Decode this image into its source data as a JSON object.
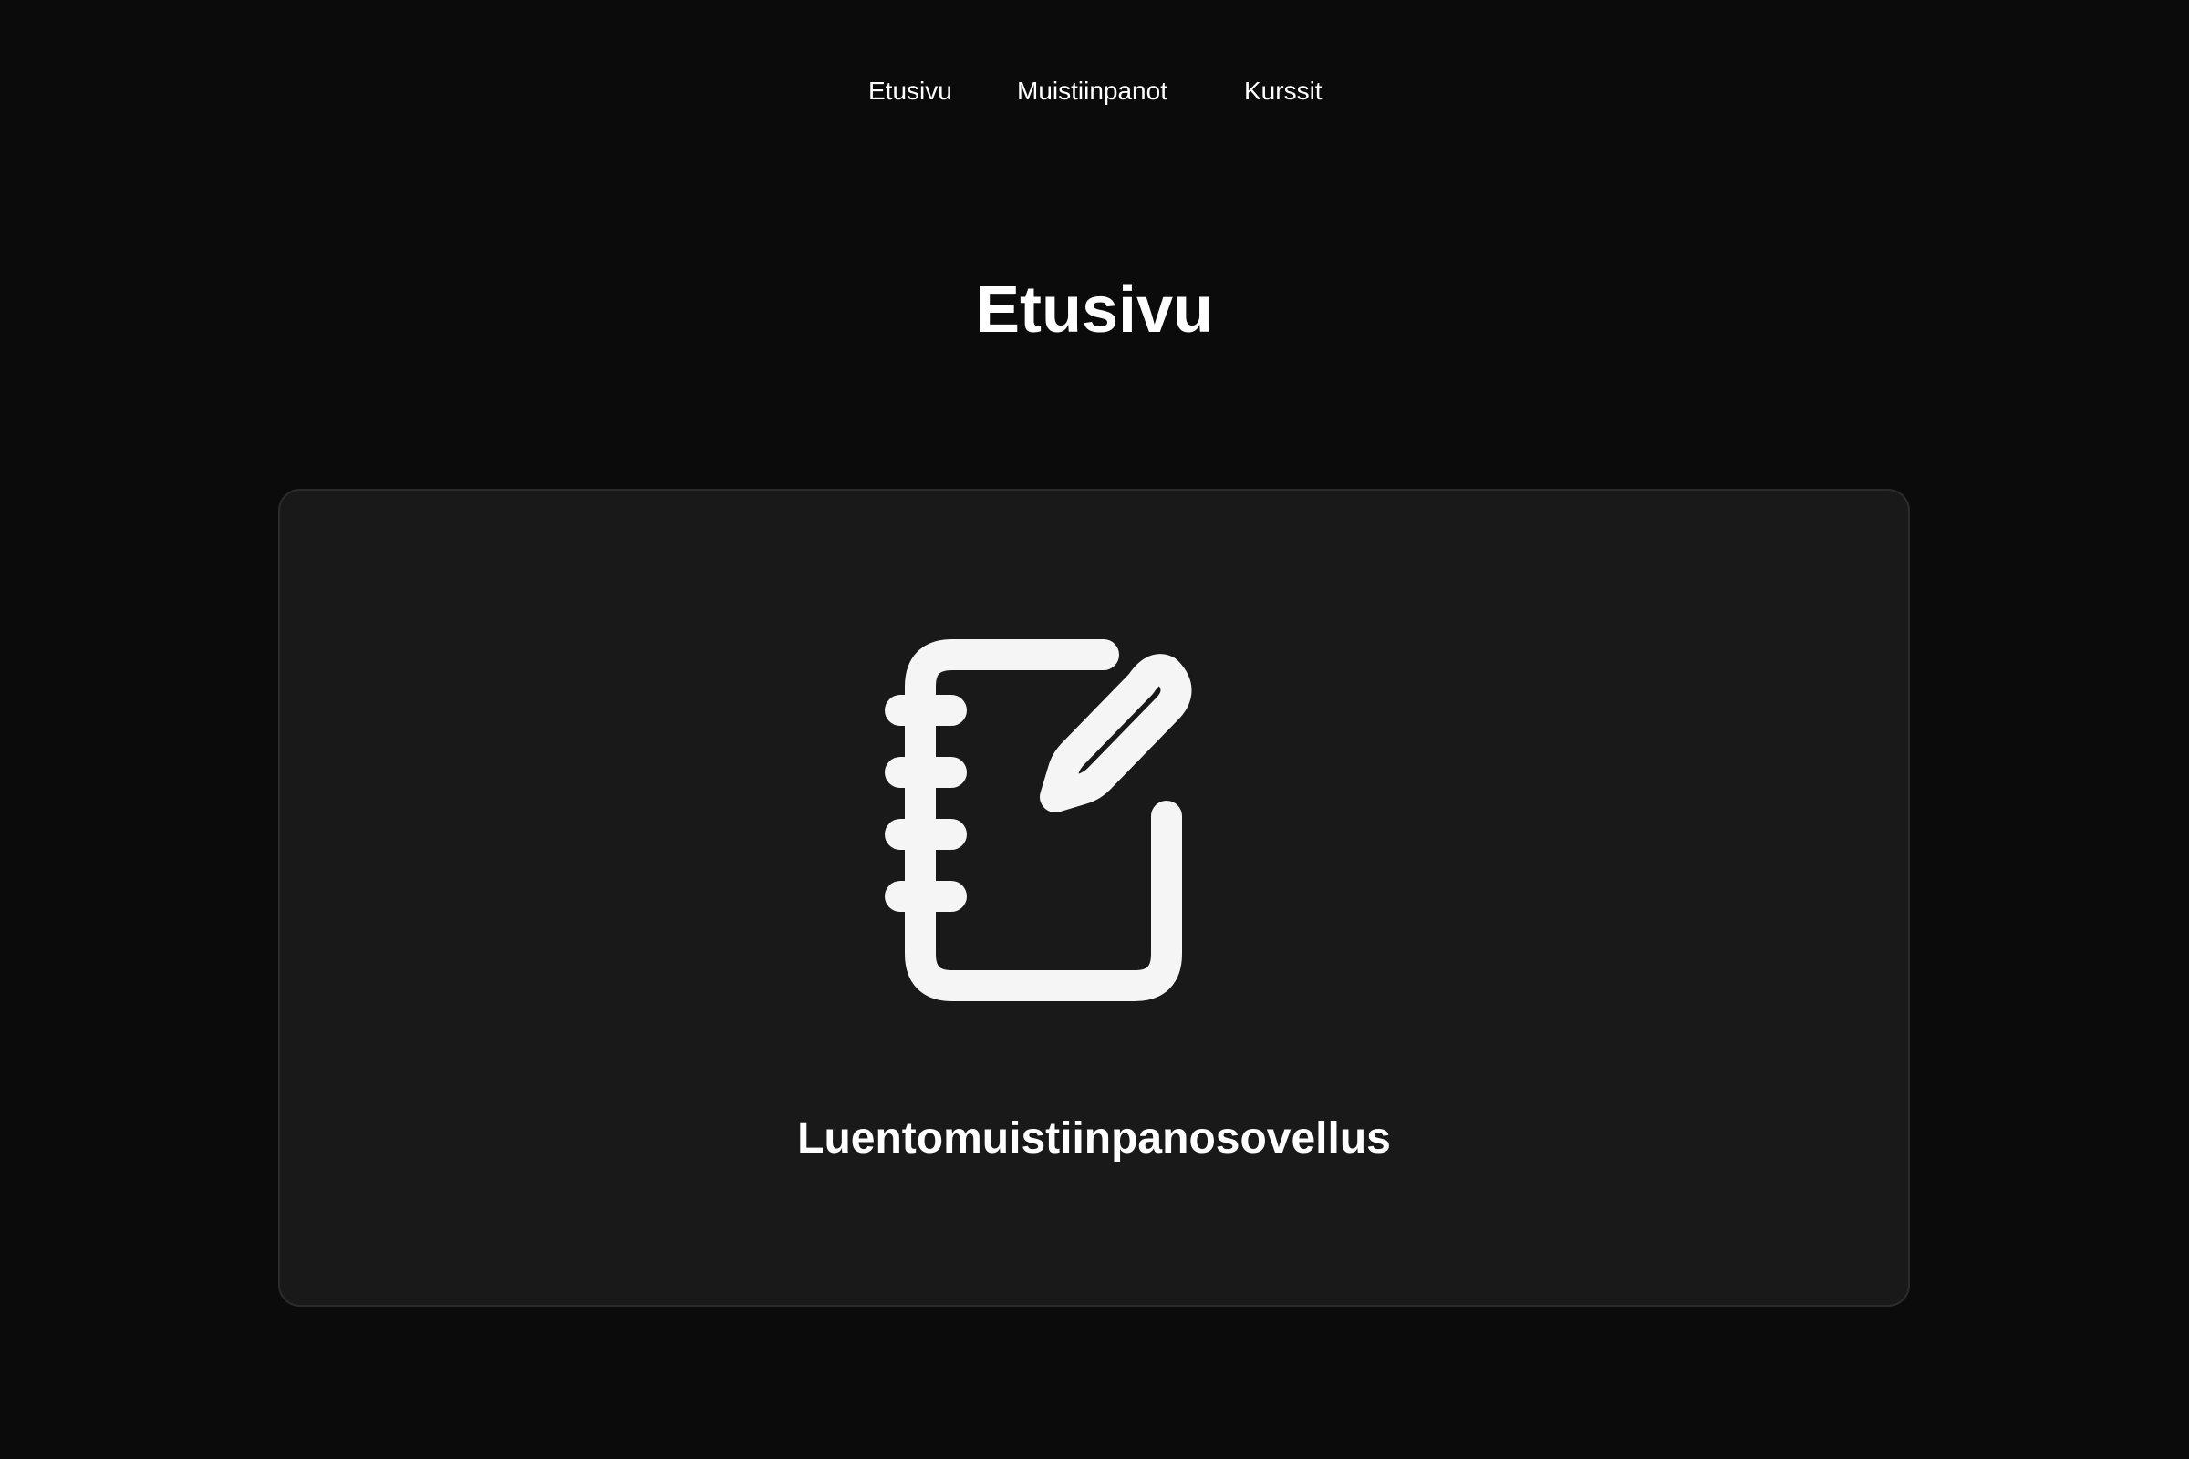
{
  "nav": {
    "items": [
      {
        "label": "Etusivu"
      },
      {
        "label": "Muistiinpanot"
      },
      {
        "label": "Kurssit"
      }
    ]
  },
  "page": {
    "title": "Etusivu"
  },
  "hero": {
    "icon": "notebook-pen-icon",
    "app_name": "Luentomuistiinpanosovellus"
  },
  "colors": {
    "background": "#0b0b0b",
    "card_background": "#191919",
    "card_border": "#2b2b2b",
    "text": "#ffffff",
    "icon": "#f5f5f5"
  }
}
